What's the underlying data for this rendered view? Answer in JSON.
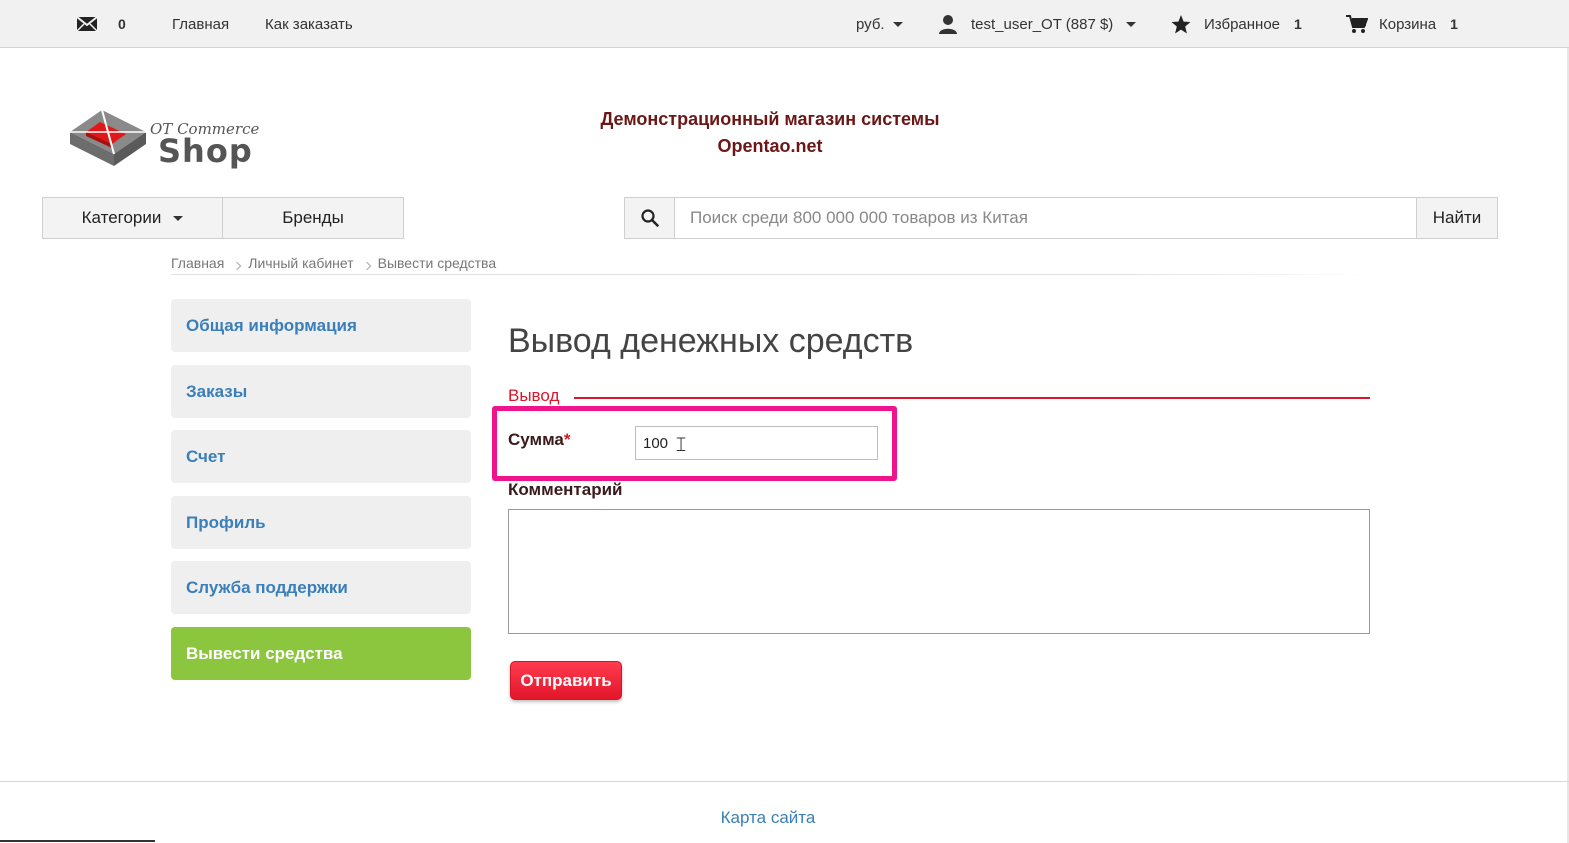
{
  "topbar": {
    "messages_count": "0",
    "nav_home": "Главная",
    "nav_how_to_order": "Как заказать",
    "currency": "руб.",
    "user": "test_user_OT (887 $)",
    "favorites_label": "Избранное",
    "favorites_count": "1",
    "cart_label": "Корзина",
    "cart_count": "1"
  },
  "header": {
    "logo_top": "OT Commerce",
    "logo_main": "Shop",
    "slogan_line1": "Демонстрационный магазин системы",
    "slogan_line2": "Opentao.net"
  },
  "nav": {
    "categories": "Категории",
    "brands": "Бренды"
  },
  "search": {
    "placeholder": "Поиск среди 800 000 000 товаров из Китая",
    "button": "Найти"
  },
  "breadcrumb": [
    "Главная",
    "Личный кабинет",
    "Вывести средства"
  ],
  "sidebar": {
    "items": [
      {
        "label": "Общая информация"
      },
      {
        "label": "Заказы"
      },
      {
        "label": "Счет"
      },
      {
        "label": "Профиль"
      },
      {
        "label": "Служба поддержки"
      },
      {
        "label": "Вывести средства"
      }
    ]
  },
  "main": {
    "title": "Вывод денежных средств",
    "legend": "Вывод",
    "sum_label": "Сумма",
    "required_mark": "*",
    "sum_value": "100",
    "comment_label": "Комментарий",
    "comment_value": "",
    "submit": "Отправить"
  },
  "footer": {
    "sitemap": "Карта сайта"
  },
  "colors": {
    "accent_red": "#d9172a",
    "active_green": "#8cc63f",
    "link_blue": "#3a7fb9",
    "highlight_pink": "#f0148c"
  }
}
